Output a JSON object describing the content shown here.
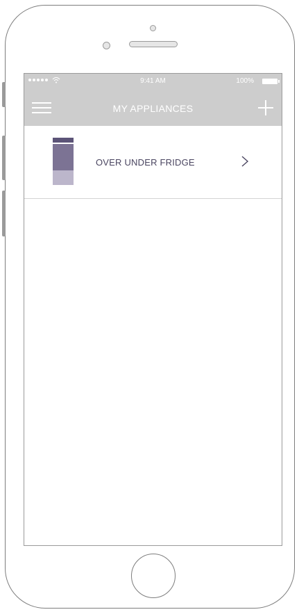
{
  "status_bar": {
    "time": "9:41 AM",
    "battery_percent": "100%"
  },
  "navbar": {
    "title": "MY APPLIANCES",
    "left_icon": "hamburger-menu-icon",
    "right_icon": "plus-icon"
  },
  "appliances": [
    {
      "label": "OVER UNDER FRIDGE",
      "icon": "fridge-icon"
    }
  ],
  "colors": {
    "header_bg": "#cdcdcd",
    "fridge_top": "#5c5478",
    "fridge_mid": "#7c7394",
    "fridge_bottom": "#bcb6cb",
    "label_text": "#4a4560"
  }
}
